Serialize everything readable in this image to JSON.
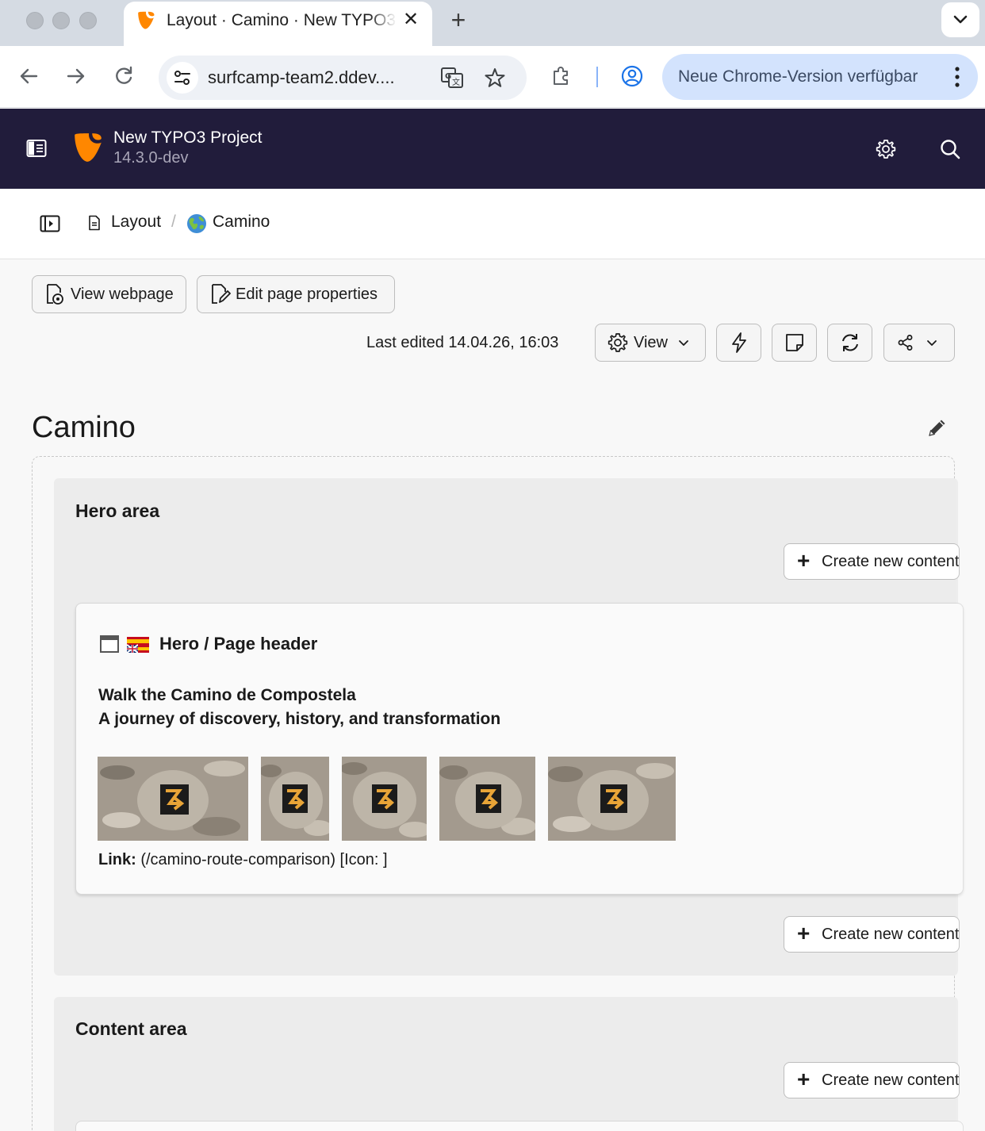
{
  "browser": {
    "tab": {
      "title": "Layout · Camino · New TYPO3"
    },
    "address": {
      "url": "surfcamp-team2.ddev...."
    },
    "update_notice": "Neue Chrome-Version verfügbar"
  },
  "typo3": {
    "site_name": "New TYPO3 Project",
    "version": "14.3.0-dev"
  },
  "breadcrumb": {
    "module": "Layout",
    "separator": "/",
    "page": "Camino"
  },
  "actions": {
    "view_webpage": "View webpage",
    "edit_page_properties": "Edit page properties",
    "last_edited": "Last edited 14.04.26, 16:03",
    "view_menu": "View"
  },
  "page": {
    "title": "Camino"
  },
  "columns": [
    {
      "title": "Hero area",
      "create_label": "Create new content"
    },
    {
      "title": "Content area",
      "create_label": "Create new content"
    }
  ],
  "content_element": {
    "type_label": "Hero / Page header",
    "header": "Walk the Camino de Compostela",
    "subheader": "A journey of discovery, history, and transformation",
    "images": [
      {
        "alt": "camino-marker-1"
      },
      {
        "alt": "camino-marker-2"
      },
      {
        "alt": "camino-marker-3"
      },
      {
        "alt": "camino-marker-4"
      },
      {
        "alt": "camino-marker-5"
      }
    ],
    "link_label": "Link:",
    "link_value": "(/camino-route-comparison) [Icon: ]"
  },
  "colors": {
    "typo3_header": "#211c3b",
    "typo3_orange": "#ff8700",
    "chrome_update_pill": "#d3e3fd",
    "column_bg": "#ececec"
  }
}
